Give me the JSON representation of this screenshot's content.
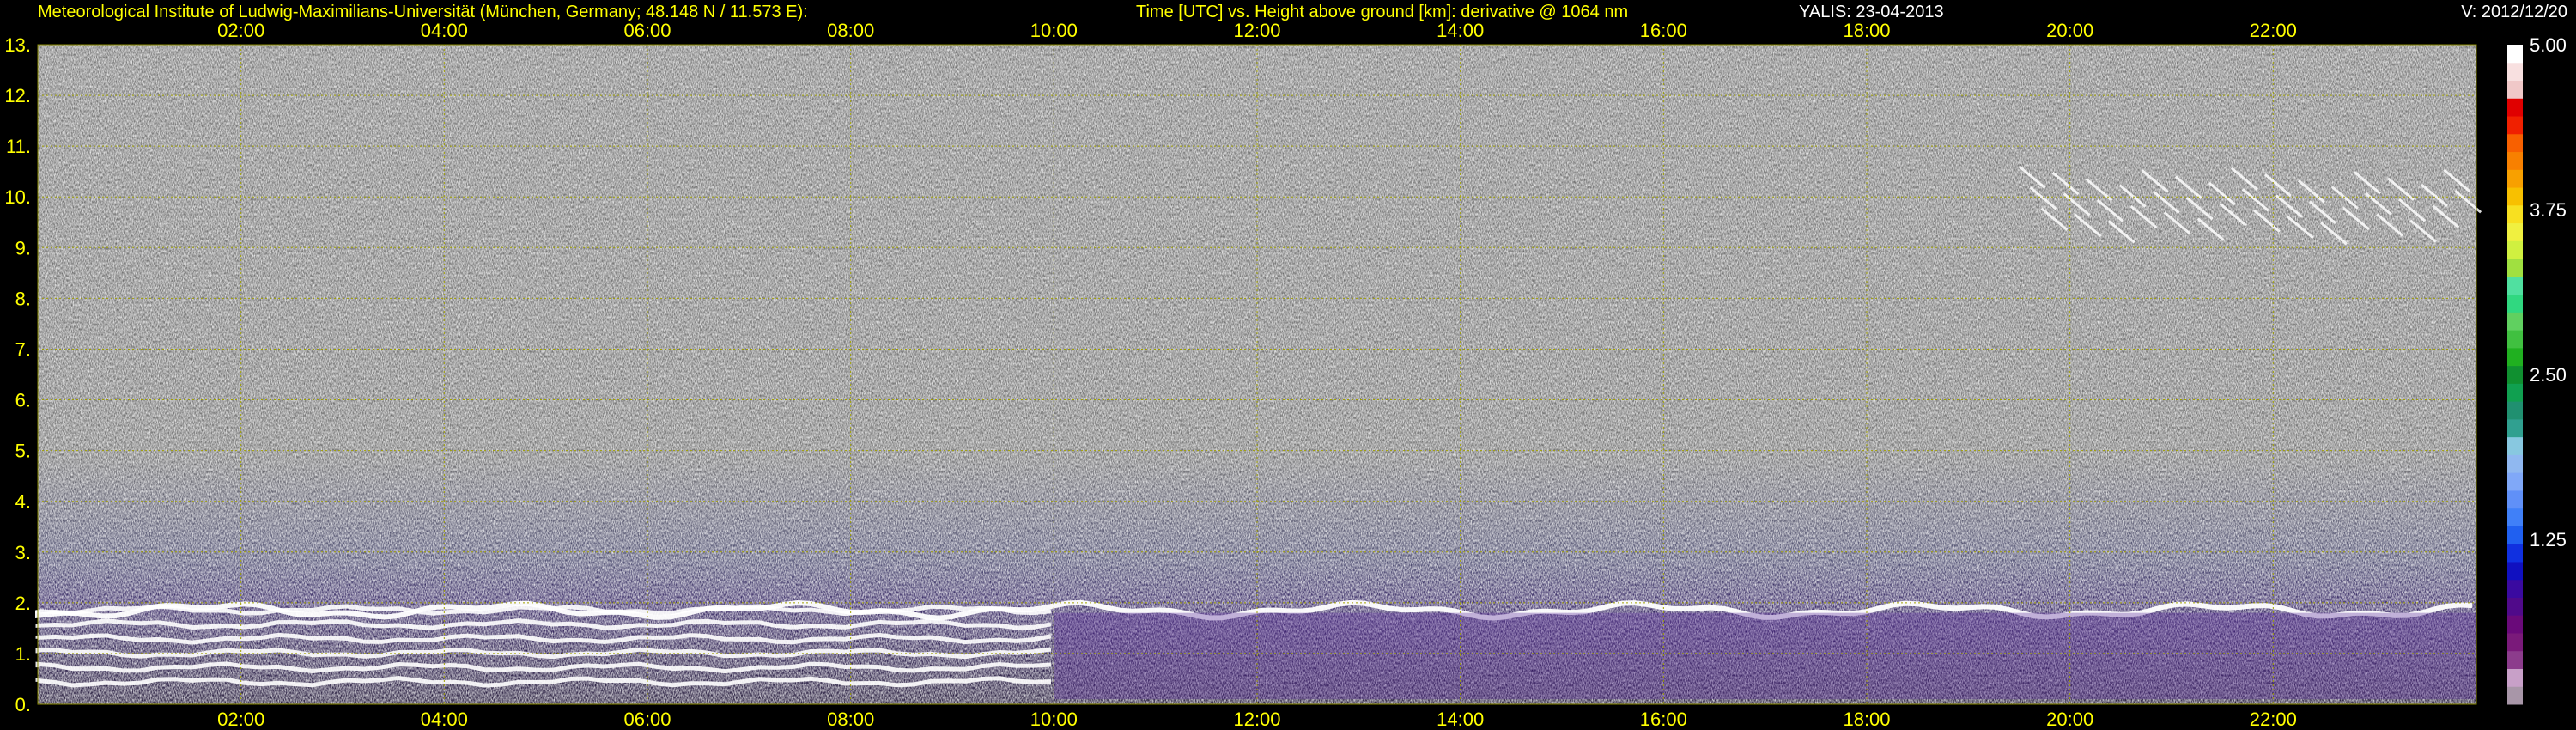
{
  "header": {
    "institute": "Meteorological Institute of Ludwig-Maximilians-Universität (München, Germany; 48.148 N / 11.573 E):",
    "title": "Time [UTC] vs. Height above ground [km]: derivative @ 1064 nm",
    "instrument_date": "YALIS: 23-04-2013",
    "version": "V: 2012/12/20"
  },
  "chart_data": {
    "type": "heatmap",
    "x_ticks": [
      "02:00",
      "04:00",
      "06:00",
      "08:00",
      "10:00",
      "12:00",
      "14:00",
      "16:00",
      "18:00",
      "20:00",
      "22:00"
    ],
    "x_tick_hours": [
      2,
      4,
      6,
      8,
      10,
      12,
      14,
      16,
      18,
      20,
      22
    ],
    "xlim_hours": [
      0,
      24
    ],
    "y_ticks": [
      "0.",
      "1.",
      "2.",
      "3.",
      "4.",
      "5.",
      "6.",
      "7.",
      "8.",
      "9.",
      "10.",
      "11.",
      "12.",
      "13."
    ],
    "y_tick_values": [
      0,
      1,
      2,
      3,
      4,
      5,
      6,
      7,
      8,
      9,
      10,
      11,
      12,
      13
    ],
    "ylim_km": [
      0,
      13
    ],
    "grid": true,
    "colorbar": {
      "ticks": [
        "1.25",
        "2.50",
        "3.75",
        "5.00"
      ],
      "tick_values": [
        1.25,
        2.5,
        3.75,
        5.0
      ],
      "range": [
        0,
        5.0
      ],
      "colors": [
        "#a896a8",
        "#c8a0c8",
        "#8c3c8c",
        "#7a1a7a",
        "#6a0a7a",
        "#500a8a",
        "#3a0aa0",
        "#1010c0",
        "#1030e0",
        "#2060f0",
        "#4080f8",
        "#6090f8",
        "#80a8f8",
        "#90b8f0",
        "#88c8e0",
        "#30a090",
        "#209070",
        "#10a050",
        "#109030",
        "#20b020",
        "#40c040",
        "#60d060",
        "#30d880",
        "#50e0a0",
        "#a0e040",
        "#d0f040",
        "#f0f040",
        "#f8e020",
        "#f8c000",
        "#f8a000",
        "#f88000",
        "#f86000",
        "#f02000",
        "#e00000",
        "#f0c8c8",
        "#f8e0e0",
        "#ffffff"
      ]
    },
    "features": [
      {
        "name": "boundary layer aerosol bands",
        "hours": [
          0,
          10
        ],
        "height_km": [
          0.3,
          2.0
        ]
      },
      {
        "name": "aerosol layer top",
        "hours": [
          0,
          24
        ],
        "height_km": [
          1.6,
          2.1
        ]
      },
      {
        "name": "cirrus cloud",
        "hours": [
          19.5,
          23.9
        ],
        "height_km": [
          9.0,
          10.6
        ]
      }
    ]
  }
}
